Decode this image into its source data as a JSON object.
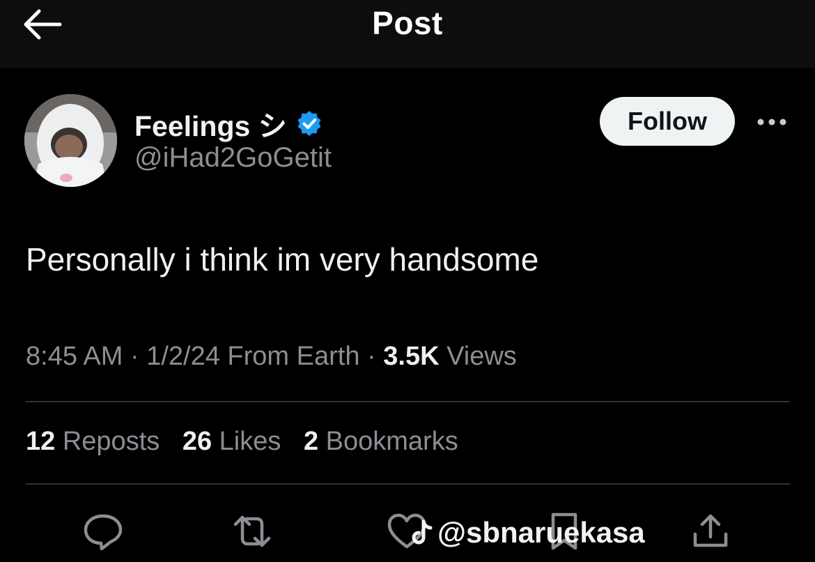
{
  "header": {
    "title": "Post",
    "back_icon": "arrow-left-icon"
  },
  "author": {
    "display_name": "Feelings シ",
    "handle": "@iHad2GoGetit",
    "verified": true,
    "verified_color": "#1d9bf0",
    "follow_label": "Follow",
    "more_icon": "more-horizontal-icon"
  },
  "post": {
    "text": "Personally i think im very handsome",
    "time": "8:45 AM",
    "date": "1/2/24",
    "source": "From Earth",
    "views_count": "3.5K",
    "views_label": "Views",
    "separator": "·"
  },
  "stats": [
    {
      "count": "12",
      "label": "Reposts"
    },
    {
      "count": "26",
      "label": "Likes"
    },
    {
      "count": "2",
      "label": "Bookmarks"
    }
  ],
  "actions": [
    "reply-icon",
    "repost-icon",
    "like-icon",
    "bookmark-icon",
    "share-icon"
  ],
  "watermark": {
    "text": "@sbnaruekasa",
    "icon": "tiktok-icon"
  },
  "colors": {
    "background": "#000000",
    "header_bg": "#0d0d0d",
    "muted_text": "#8b8f94",
    "divider": "#2f3336"
  }
}
